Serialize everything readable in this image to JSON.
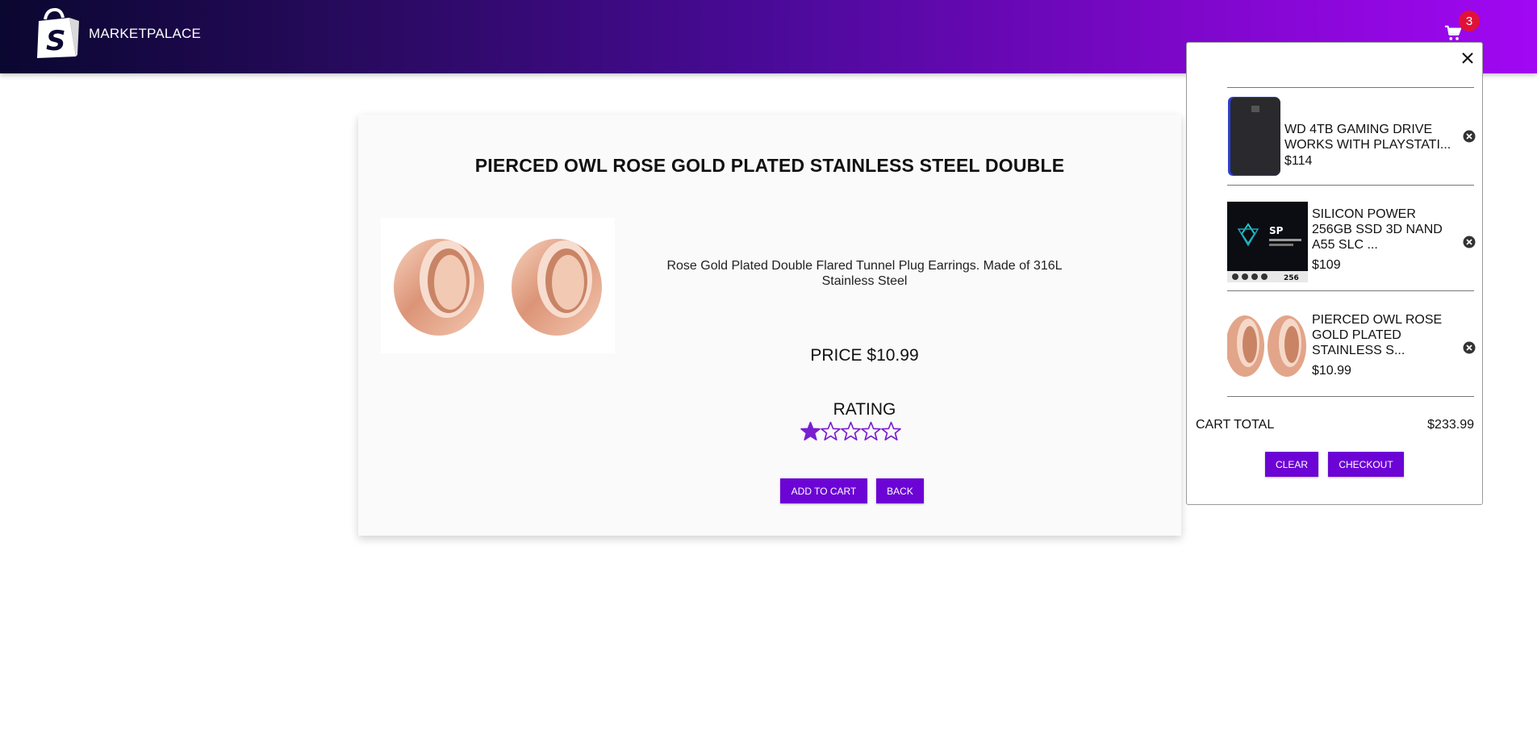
{
  "header": {
    "brand_name": "MARKETPALACE",
    "logo_icon": "shopping-bag-icon",
    "cart_icon": "cart-icon",
    "cart_count": "3",
    "gradient_start": "#0a0730",
    "gradient_end": "#a107f3"
  },
  "product": {
    "title": "PIERCED OWL ROSE GOLD PLATED STAINLESS STEEL DOUBLE",
    "description": "Rose Gold Plated Double Flared Tunnel Plug Earrings. Made of 316L Stainless Steel",
    "price_text": "PRICE $10.99",
    "rating_label": "RATING",
    "rating": 1,
    "rating_max": 5,
    "add_to_cart_label": "ADD TO CART",
    "back_label": "BACK"
  },
  "cart": {
    "close_icon": "close-icon",
    "items": [
      {
        "name": "WD 4TB GAMING DRIVE WORKS WITH PLAYSTATI...",
        "price": "$114"
      },
      {
        "name": "SILICON POWER 256GB SSD 3D NAND A55 SLC ...",
        "price": "$109"
      },
      {
        "name": "PIERCED OWL ROSE GOLD PLATED STAINLESS S...",
        "price": "$10.99"
      }
    ],
    "total_label": "CART TOTAL",
    "total_value": "$233.99",
    "clear_label": "CLEAR",
    "checkout_label": "CHECKOUT"
  },
  "colors": {
    "accent": "#6b04d4",
    "badge": "#e0123a",
    "star": "#7a1fd1"
  }
}
